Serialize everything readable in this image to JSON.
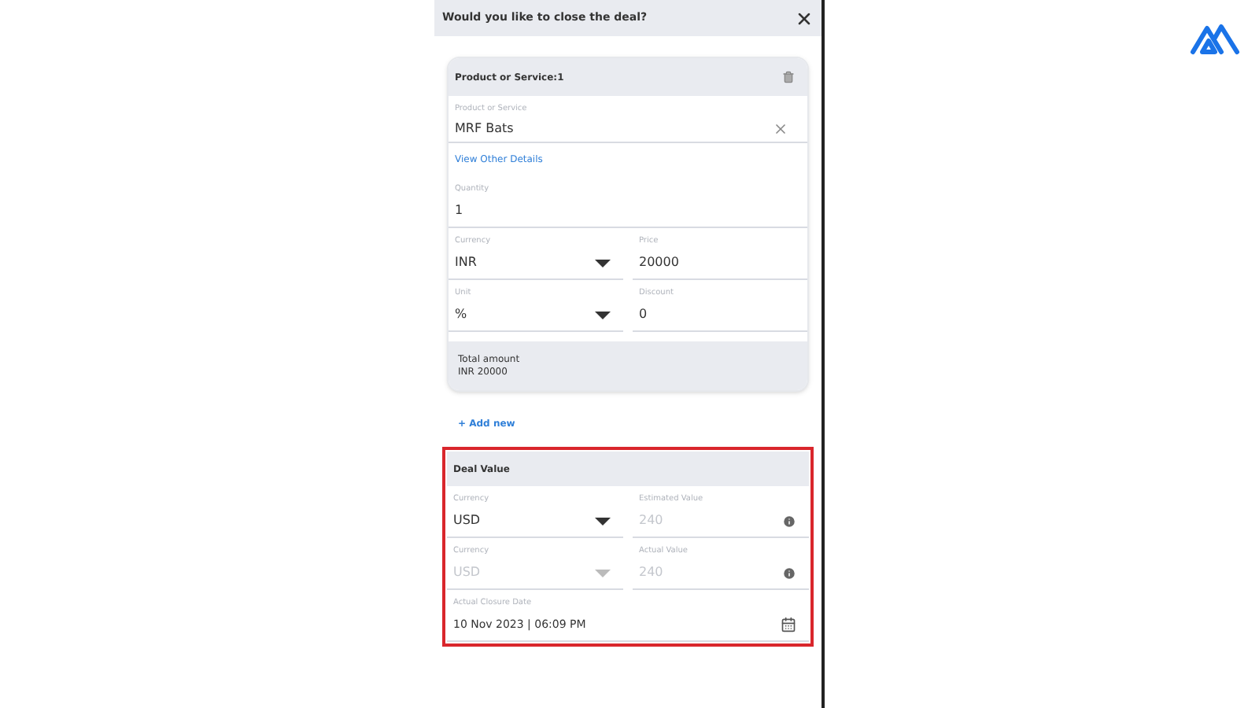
{
  "dialog": {
    "title": "Would you like to close the deal?"
  },
  "product_card": {
    "title": "Product or Service:1",
    "product": {
      "label": "Product or Service",
      "value": "MRF Bats"
    },
    "link": "View Other Details",
    "quantity": {
      "label": "Quantity",
      "value": "1"
    },
    "rows": [
      [
        {
          "kind": "select",
          "label": "Currency",
          "value": "INR",
          "disabled": false
        },
        {
          "kind": "text",
          "label": "Price",
          "value": "20000",
          "disabled": false
        }
      ],
      [
        {
          "kind": "select",
          "label": "Unit",
          "value": "%",
          "disabled": false
        },
        {
          "kind": "text",
          "label": "Discount",
          "value": "0",
          "disabled": false
        }
      ]
    ],
    "total": {
      "label": "Total amount",
      "value": "INR 20000"
    }
  },
  "add_new": "+ Add new",
  "deal_value": {
    "title": "Deal Value",
    "highlighted": true,
    "rows": [
      [
        {
          "kind": "select",
          "label": "Currency",
          "value": "USD",
          "disabled": false
        },
        {
          "kind": "info",
          "label": "Estimated Value",
          "value": "240",
          "disabled": true
        }
      ],
      [
        {
          "kind": "select",
          "label": "Currency",
          "value": "USD",
          "disabled": true
        },
        {
          "kind": "info",
          "label": "Actual Value",
          "value": "240",
          "disabled": true
        }
      ]
    ],
    "closure_date": {
      "label": "Actual Closure Date",
      "value": "10 Nov 2023 | 06:09 PM"
    }
  }
}
